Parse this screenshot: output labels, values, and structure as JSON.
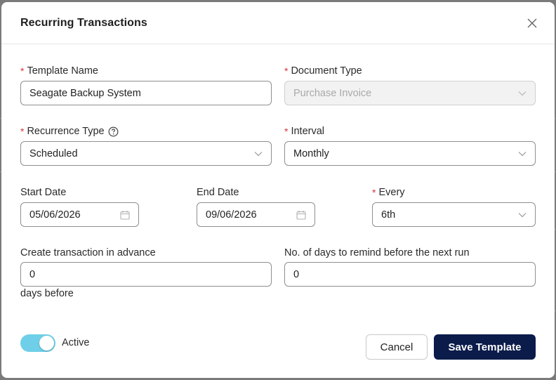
{
  "dialog": {
    "title": "Recurring Transactions"
  },
  "form": {
    "template_name": {
      "label": "Template Name",
      "value": "Seagate Backup System"
    },
    "document_type": {
      "label": "Document Type",
      "value": "Purchase Invoice"
    },
    "recurrence_type": {
      "label": "Recurrence Type",
      "value": "Scheduled"
    },
    "interval": {
      "label": "Interval",
      "value": "Monthly"
    },
    "start_date": {
      "label": "Start Date",
      "value": "05/06/2026"
    },
    "end_date": {
      "label": "End Date",
      "value": "09/06/2026"
    },
    "every": {
      "label": "Every",
      "value": "6th"
    },
    "advance": {
      "label": "Create transaction in advance",
      "value": "0",
      "suffix": "days before"
    },
    "remind": {
      "label": "No. of days to remind before the next run",
      "value": "0"
    }
  },
  "footer": {
    "active_label": "Active",
    "active_on": true,
    "cancel_label": "Cancel",
    "save_label": "Save Template"
  },
  "colors": {
    "primary": "#0b1b4a",
    "toggle_on": "#6fcfe8",
    "required": "#d9363e"
  }
}
